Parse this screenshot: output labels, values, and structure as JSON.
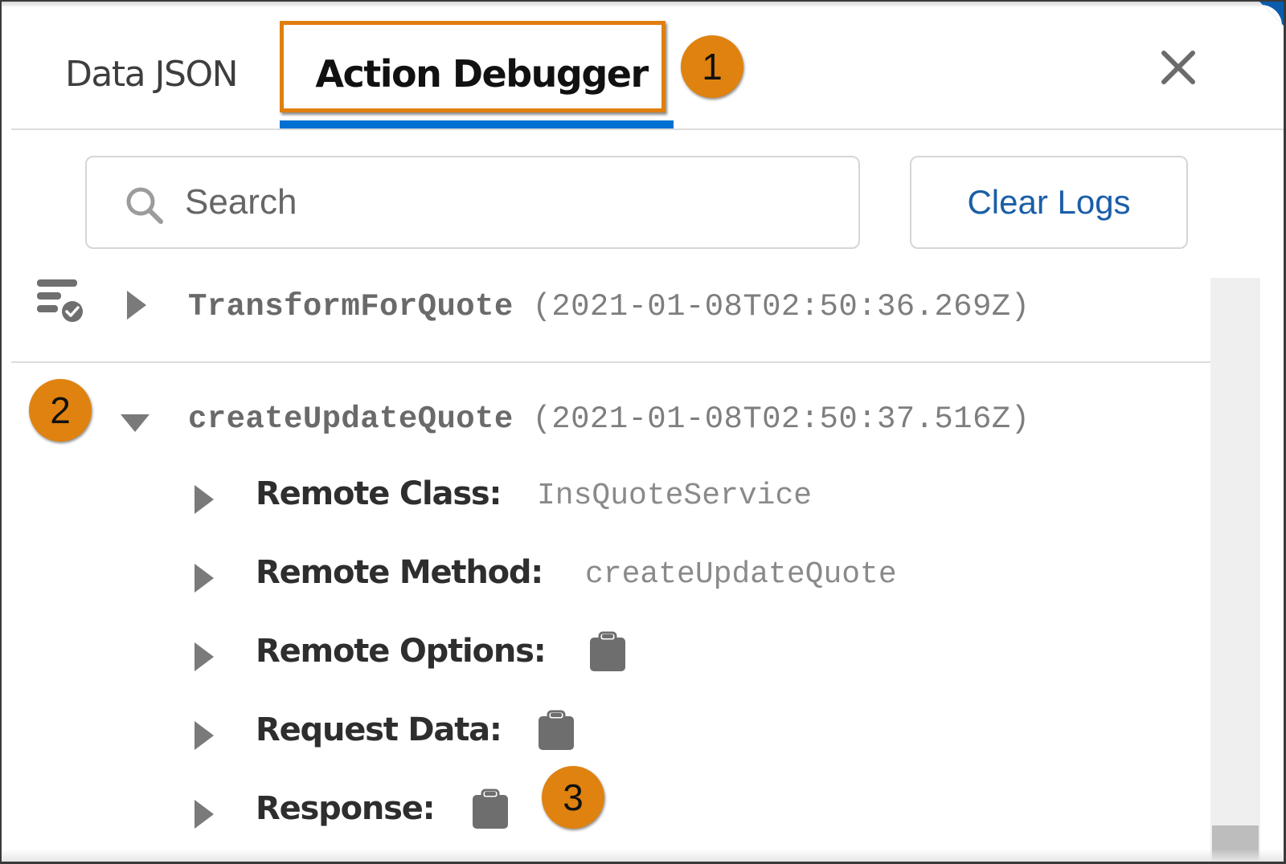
{
  "tabs": [
    {
      "label": "Data JSON",
      "active": false
    },
    {
      "label": "Action Debugger",
      "active": true
    }
  ],
  "close_icon": "close-icon",
  "search": {
    "placeholder": "Search",
    "value": "",
    "icon": "search-icon"
  },
  "toolbar": {
    "clear_logs_label": "Clear Logs"
  },
  "callouts": [
    "1",
    "2",
    "3"
  ],
  "logs": [
    {
      "name": "TransformForQuote",
      "timestamp": "(2021-01-08T02:50:36.269Z)",
      "expanded": false,
      "icon": "log-check-icon"
    },
    {
      "name": "createUpdateQuote",
      "timestamp": "(2021-01-08T02:50:37.516Z)",
      "expanded": true,
      "details": [
        {
          "label": "Remote Class:",
          "value": "InsQuoteService"
        },
        {
          "label": "Remote Method:",
          "value": "createUpdateQuote"
        },
        {
          "label": "Remote Options:",
          "value": null,
          "icon": "clipboard-icon"
        },
        {
          "label": "Request Data:",
          "value": null,
          "icon": "clipboard-icon"
        },
        {
          "label": "Response:",
          "value": null,
          "icon": "clipboard-icon"
        }
      ]
    }
  ],
  "colors": {
    "accent_blue": "#0070d2",
    "link_blue": "#1a5ea8",
    "callout_orange": "#e0820f"
  }
}
